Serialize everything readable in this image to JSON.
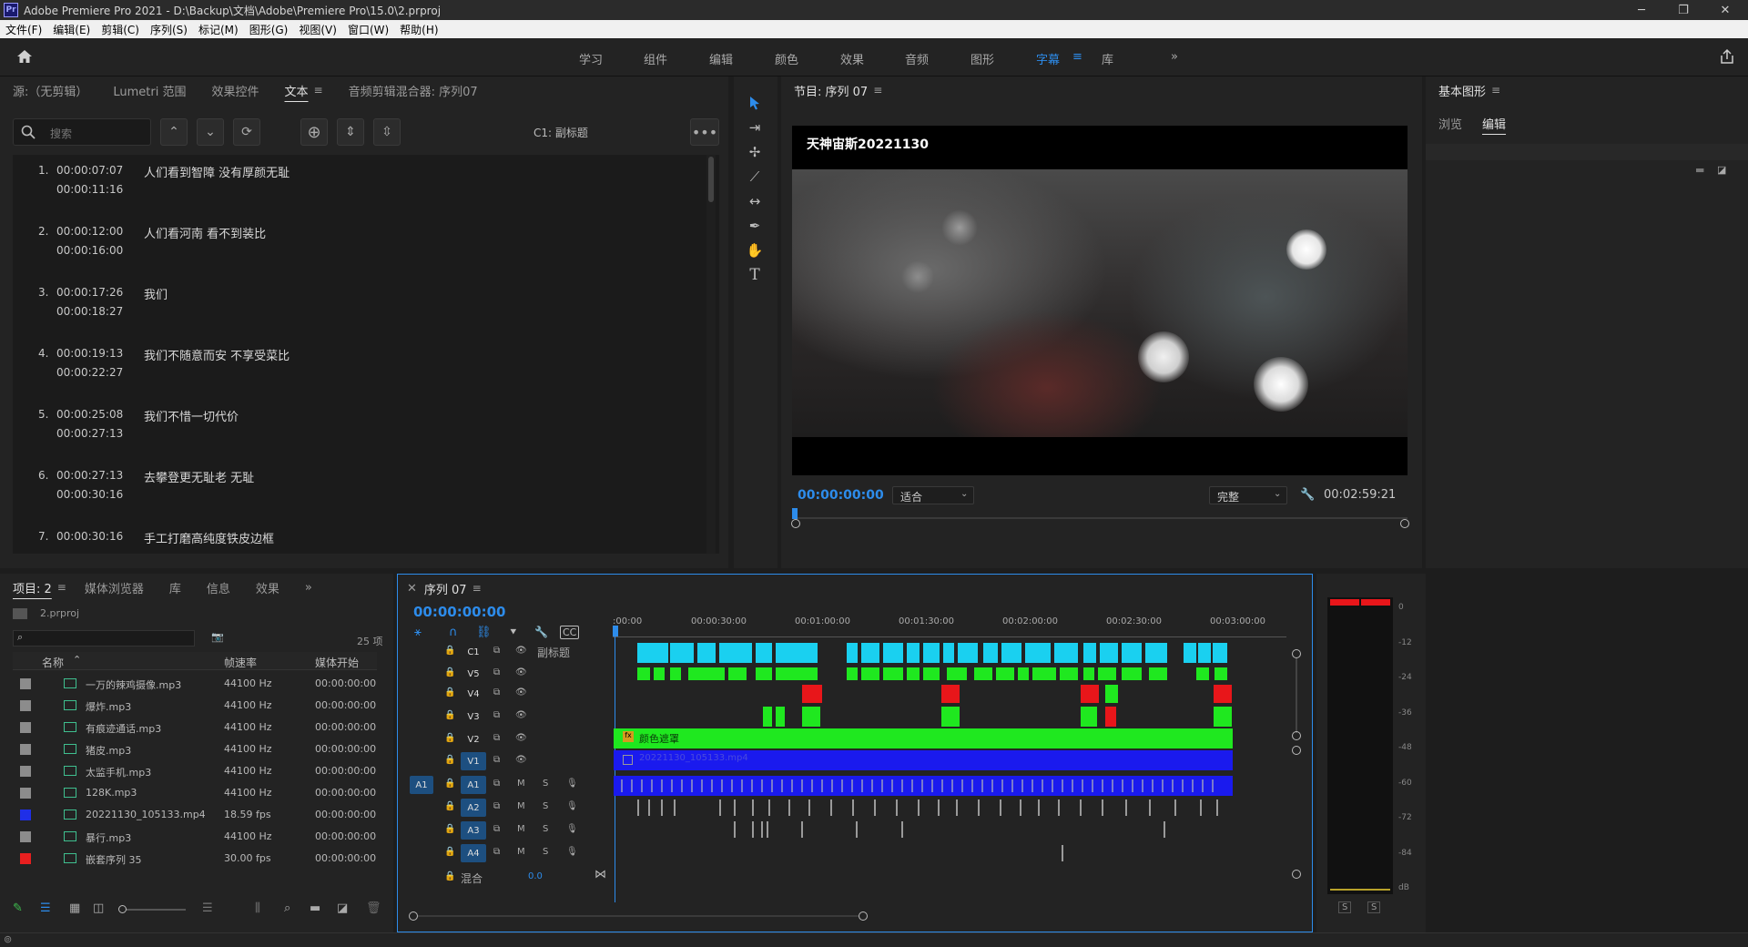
{
  "window": {
    "app_icon": "Pr",
    "title": "Adobe Premiere Pro 2021 - D:\\Backup\\文档\\Adobe\\Premiere Pro\\15.0\\2.prproj"
  },
  "menu": [
    "文件(F)",
    "编辑(E)",
    "剪辑(C)",
    "序列(S)",
    "标记(M)",
    "图形(G)",
    "视图(V)",
    "窗口(W)",
    "帮助(H)"
  ],
  "workspaces": {
    "items": [
      "学习",
      "组件",
      "编辑",
      "颜色",
      "效果",
      "音频",
      "图形",
      "字幕",
      "库"
    ],
    "active": "字幕",
    "more": "»"
  },
  "source_panel": {
    "tabs": [
      "源:（无剪辑）",
      "Lumetri 范围",
      "效果控件",
      "文本",
      "音频剪辑混合器: 序列07"
    ],
    "active_tab": "文本",
    "search_placeholder": "搜索",
    "track_label": "C1: 副标题",
    "captions": [
      {
        "num": "1.",
        "in": "00:00:07:07",
        "out": "00:00:11:16",
        "text": "人们看到智障 没有厚颜无耻"
      },
      {
        "num": "2.",
        "in": "00:00:12:00",
        "out": "00:00:16:00",
        "text": "人们看河南 看不到装比"
      },
      {
        "num": "3.",
        "in": "00:00:17:26",
        "out": "00:00:18:27",
        "text": "我们"
      },
      {
        "num": "4.",
        "in": "00:00:19:13",
        "out": "00:00:22:27",
        "text": "我们不随意而安 不享受菜比"
      },
      {
        "num": "5.",
        "in": "00:00:25:08",
        "out": "00:00:27:13",
        "text": "我们不惜一切代价"
      },
      {
        "num": "6.",
        "in": "00:00:27:13",
        "out": "00:00:30:16",
        "text": "去攀登更无耻老 无耻"
      },
      {
        "num": "7.",
        "in": "00:00:30:16",
        "out": "",
        "text": "手工打磨高纯度铁皮边框"
      }
    ]
  },
  "program_monitor": {
    "tab": "节目: 序列 07",
    "overlay_text": "天神宙斯20221130",
    "timecode": "00:00:00:00",
    "fit": "适合",
    "quality": "完整",
    "duration": "00:02:59:21"
  },
  "essential_graphics": {
    "tab": "基本图形",
    "subtabs": [
      "浏览",
      "编辑"
    ],
    "active_subtab": "编辑"
  },
  "project_panel": {
    "tabs": [
      "项目: 2",
      "媒体浏览器",
      "库",
      "信息",
      "效果"
    ],
    "active_tab": "项目: 2",
    "file": "2.prproj",
    "count": "25 项",
    "columns": [
      "名称",
      "帧速率",
      "媒体开始"
    ],
    "rows": [
      {
        "name": "一万的辣鸡摄像.mp3",
        "rate": "44100 Hz",
        "start": "00:00:00:00",
        "color": "#8c8c8c",
        "type": "audio"
      },
      {
        "name": "爆炸.mp3",
        "rate": "44100 Hz",
        "start": "00:00:00:00",
        "color": "#8c8c8c",
        "type": "audio"
      },
      {
        "name": "有痕迹通话.mp3",
        "rate": "44100 Hz",
        "start": "00:00:00:00",
        "color": "#8c8c8c",
        "type": "audio"
      },
      {
        "name": "猪皮.mp3",
        "rate": "44100 Hz",
        "start": "00:00:00:00",
        "color": "#8c8c8c",
        "type": "audio"
      },
      {
        "name": "太监手机.mp3",
        "rate": "44100 Hz",
        "start": "00:00:00:00",
        "color": "#8c8c8c",
        "type": "audio"
      },
      {
        "name": "128K.mp3",
        "rate": "44100 Hz",
        "start": "00:00:00:00",
        "color": "#8c8c8c",
        "type": "audio"
      },
      {
        "name": "20221130_105133.mp4",
        "rate": "18.59 fps",
        "start": "00:00:00:00",
        "color": "#1f2fe8",
        "type": "video"
      },
      {
        "name": "暴行.mp3",
        "rate": "44100 Hz",
        "start": "00:00:00:00",
        "color": "#8c8c8c",
        "type": "audio"
      },
      {
        "name": "嵌套序列 35",
        "rate": "30.00 fps",
        "start": "00:00:00:00",
        "color": "#e81f1f",
        "type": "sequence"
      }
    ]
  },
  "timeline": {
    "tab": "序列 07",
    "timecode": "00:00:00:00",
    "ruler": [
      ":00:00",
      "00:00:30:00",
      "00:01:00:00",
      "00:01:30:00",
      "00:02:00:00",
      "00:02:30:00",
      "00:03:00:00"
    ],
    "tracks": [
      {
        "id": "C1",
        "name": "副标题"
      },
      {
        "id": "V5",
        "name": ""
      },
      {
        "id": "V4",
        "name": ""
      },
      {
        "id": "V3",
        "name": ""
      },
      {
        "id": "V2",
        "name": ""
      },
      {
        "id": "V1",
        "name": ""
      },
      {
        "id": "A1",
        "name": ""
      },
      {
        "id": "A2",
        "name": ""
      },
      {
        "id": "A3",
        "name": ""
      },
      {
        "id": "A4",
        "name": ""
      }
    ],
    "mix_label": "混合",
    "mix_value": "0.0",
    "v2_clip": "颜色遮罩",
    "v1_clip": "20221130_105133.mp4",
    "colors": {
      "caption": "#1ad0f0",
      "green": "#1fe81f",
      "red": "#e8161a",
      "blue": "#1a1aee",
      "playhead": "#2d8ceb"
    }
  },
  "audio_meter": {
    "scale": [
      "0",
      "-12",
      "-24",
      "-36",
      "-48",
      "-60",
      "-72",
      "-84",
      "dB"
    ],
    "solo": [
      "S",
      "S"
    ]
  }
}
